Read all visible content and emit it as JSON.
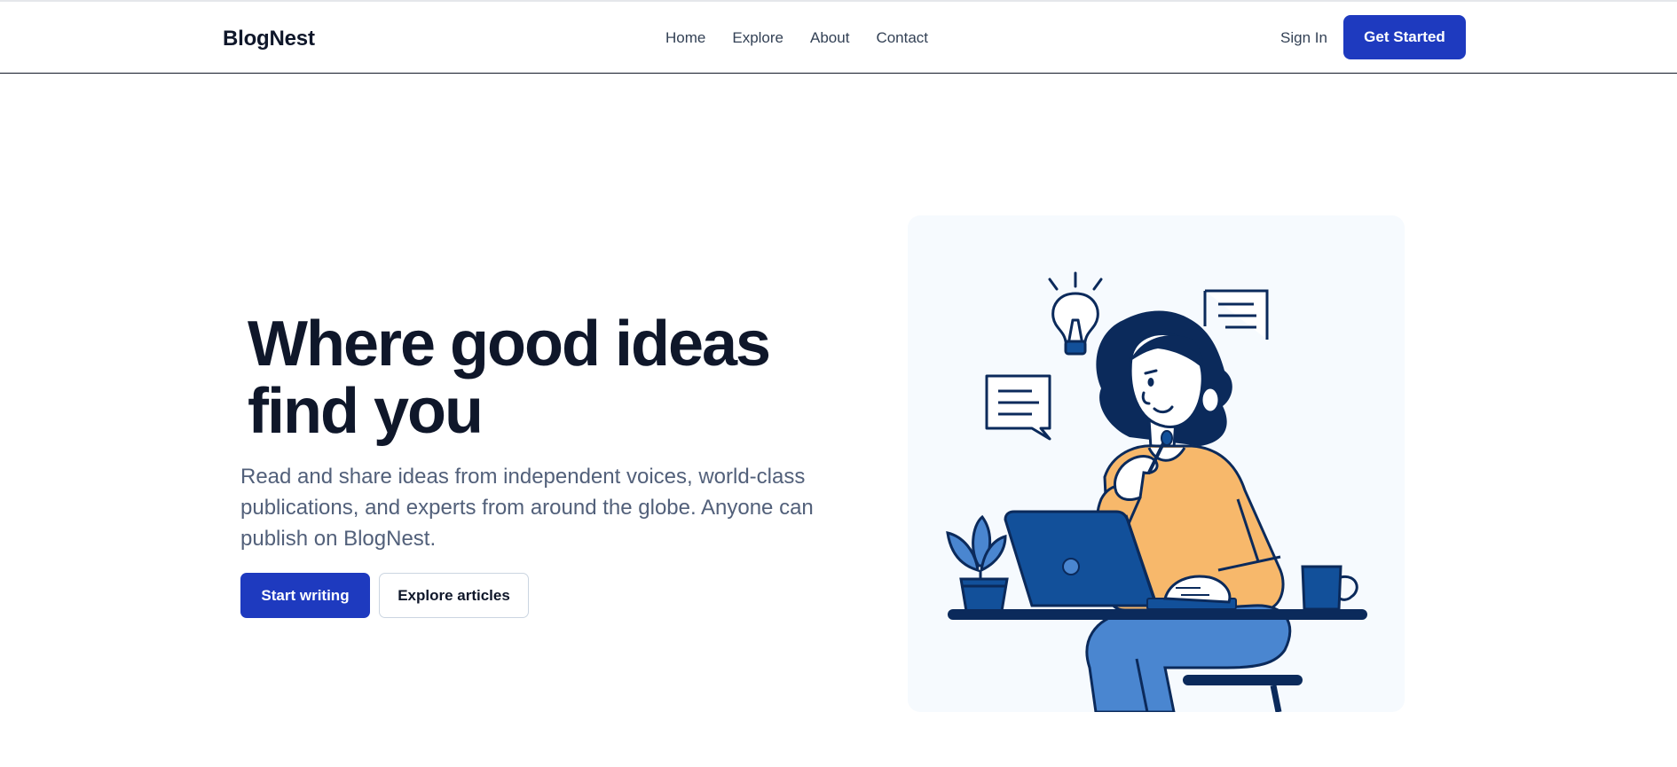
{
  "header": {
    "brand": "BlogNest",
    "nav": [
      "Home",
      "Explore",
      "About",
      "Contact"
    ],
    "sign_in": "Sign In",
    "get_started": "Get Started"
  },
  "hero": {
    "title_line1": "Where good ideas",
    "title_line2": "find you",
    "subtitle": "Read and share ideas from independent voices, world-class publications, and experts from around the globe. Anyone can publish on BlogNest.",
    "primary_cta": "Start writing",
    "secondary_cta": "Explore articles"
  },
  "illustration": {
    "icons": [
      "lightbulb-icon",
      "chat-bubble-icon",
      "document-icon",
      "laptop-icon",
      "plant-icon",
      "mug-icon"
    ]
  },
  "colors": {
    "primary": "#1e3abf",
    "navy": "#0b2a5b",
    "sweater": "#f7b86b",
    "jeans": "#4a86d0",
    "laptop": "#12509a",
    "card_bg": "#f6fafe",
    "subtitle": "#52607a"
  }
}
